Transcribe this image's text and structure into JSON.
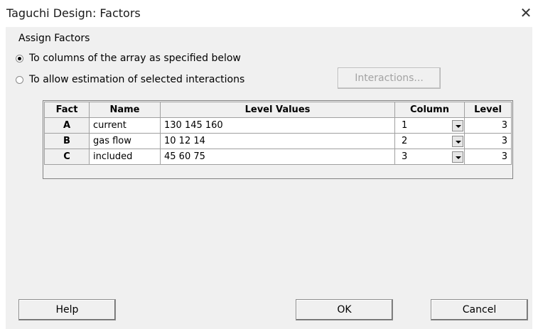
{
  "window": {
    "title": "Taguchi Design: Factors",
    "close_glyph": "✕"
  },
  "assign": {
    "label": "Assign Factors",
    "options": [
      {
        "label": "To columns of the array as specified below",
        "selected": true
      },
      {
        "label": "To allow estimation of selected interactions",
        "selected": false
      }
    ],
    "interactions_button": "Interactions..."
  },
  "table": {
    "headers": [
      "Fact",
      "Name",
      "Level Values",
      "Column",
      "Level"
    ],
    "rows": [
      {
        "fact": "A",
        "name": "current",
        "level_values": "130 145 160",
        "column": "1",
        "level": "3"
      },
      {
        "fact": "B",
        "name": "gas flow",
        "level_values": "10 12 14",
        "column": "2",
        "level": "3"
      },
      {
        "fact": "C",
        "name": "included",
        "level_values": "45 60 75",
        "column": "3",
        "level": "3"
      }
    ]
  },
  "buttons": {
    "help": "Help",
    "ok": "OK",
    "cancel": "Cancel"
  }
}
